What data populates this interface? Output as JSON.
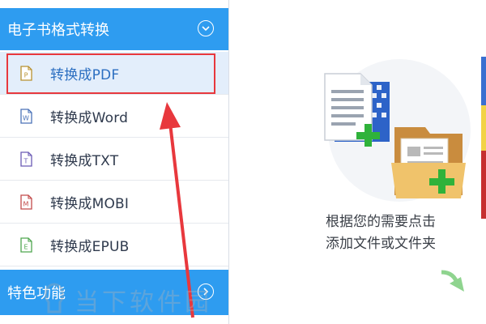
{
  "sidebar": {
    "section_convert": {
      "title": "电子书格式转换",
      "icon": "chevron-down-circle-icon"
    },
    "items": [
      {
        "label": "转换成PDF",
        "icon": "pdf-file-icon",
        "glyph": "P",
        "color": "#b8912f",
        "active": true
      },
      {
        "label": "转换成Word",
        "icon": "word-file-icon",
        "glyph": "W",
        "color": "#4a72b8",
        "active": false
      },
      {
        "label": "转换成TXT",
        "icon": "txt-file-icon",
        "glyph": "T",
        "color": "#6b5bb5",
        "active": false
      },
      {
        "label": "转换成MOBI",
        "icon": "mobi-file-icon",
        "glyph": "M",
        "color": "#c24a4a",
        "active": false
      },
      {
        "label": "转换成EPUB",
        "icon": "epub-file-icon",
        "glyph": "E",
        "color": "#4fa64f",
        "active": false
      }
    ],
    "section_features": {
      "title": "特色功能",
      "icon": "chevron-right-circle-icon"
    }
  },
  "main": {
    "hint_line1": "根据您的需要点击",
    "hint_line2": "添加文件或文件夹",
    "illustration": "add-file-folder-icon"
  },
  "watermark": {
    "text": "当下软件园"
  },
  "colors": {
    "header_blue": "#2e9cf0",
    "active_bg": "#e3eefb",
    "annotation_red": "#e8383d"
  }
}
